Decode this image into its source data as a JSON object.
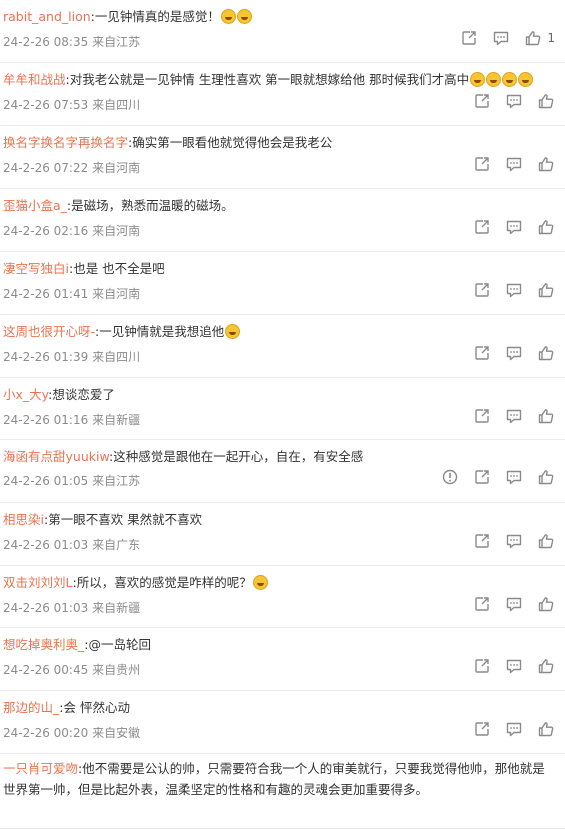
{
  "comments": [
    {
      "user": "rabit_and_lion",
      "text": "一见钟情真的是感觉！",
      "emoji_count": 2,
      "time": "24-2-26 08:35",
      "location": "来自江苏",
      "likes": "1",
      "report": false,
      "wrap": false
    },
    {
      "user": "牟牟和战战",
      "text": "对我老公就是一见钟情 生理性喜欢 第一眼就想嫁给他 那时候我们才高中",
      "emoji_count": 4,
      "time": "24-2-26 07:53",
      "location": "来自四川",
      "likes": "",
      "report": false,
      "wrap": false
    },
    {
      "user": "换名字换名字再换名字",
      "text": "确实第一眼看他就觉得他会是我老公",
      "emoji_count": 0,
      "time": "24-2-26 07:22",
      "location": "来自河南",
      "likes": "",
      "report": false,
      "wrap": false
    },
    {
      "user": "歪猫小盒a_",
      "text": "是磁场，熟悉而温暖的磁场。",
      "emoji_count": 0,
      "time": "24-2-26 02:16",
      "location": "来自河南",
      "likes": "",
      "report": false,
      "wrap": false
    },
    {
      "user": "凄空写独白i",
      "text": "也是 也不全是吧",
      "emoji_count": 0,
      "time": "24-2-26 01:41",
      "location": "来自河南",
      "likes": "",
      "report": false,
      "wrap": false
    },
    {
      "user": "这周也很开心呀-",
      "text": "一见钟情就是我想追他",
      "emoji_count": 1,
      "time": "24-2-26 01:39",
      "location": "来自四川",
      "likes": "",
      "report": false,
      "wrap": false
    },
    {
      "user": "小x_大y",
      "text": "想谈恋爱了",
      "emoji_count": 0,
      "time": "24-2-26 01:16",
      "location": "来自新疆",
      "likes": "",
      "report": false,
      "wrap": false
    },
    {
      "user": "海函有点甜yuukiw",
      "text": "这种感觉是跟他在一起开心，自在，有安全感",
      "emoji_count": 0,
      "time": "24-2-26 01:05",
      "location": "来自江苏",
      "likes": "",
      "report": true,
      "wrap": false
    },
    {
      "user": "相思染i",
      "text": "第一眼不喜欢 果然就不喜欢",
      "emoji_count": 0,
      "time": "24-2-26 01:03",
      "location": "来自广东",
      "likes": "",
      "report": false,
      "wrap": false
    },
    {
      "user": "双击刘刘刘L",
      "text": "所以，喜欢的感觉是咋样的呢？",
      "emoji_count": 1,
      "time": "24-2-26 01:03",
      "location": "来自新疆",
      "likes": "",
      "report": false,
      "wrap": false
    },
    {
      "user": "想吃掉奥利奥_",
      "text": "@一岛轮回",
      "emoji_count": 0,
      "time": "24-2-26 00:45",
      "location": "来自贵州",
      "likes": "",
      "report": false,
      "wrap": false
    },
    {
      "user": "那边的山_",
      "text": "会 怦然心动",
      "emoji_count": 0,
      "time": "24-2-26 00:20",
      "location": "来自安徽",
      "likes": "",
      "report": false,
      "wrap": false
    },
    {
      "user": "一只肖可爱吻",
      "text": "他不需要是公认的帅，只需要符合我一个人的审美就行，只要我觉得他帅，那他就是世界第一帅，但是比起外表，温柔坚定的性格和有趣的灵魂会更加重要得多。",
      "emoji_count": 0,
      "time": "",
      "location": "",
      "likes": "",
      "report": false,
      "wrap": true
    }
  ],
  "icons": {
    "share": "share-icon",
    "comment": "comment-icon",
    "like": "thumbs-up-icon",
    "report": "report-icon"
  },
  "colors": {
    "username": "#eb7350",
    "meta": "#8c8c8c",
    "icon": "#8a8a8a",
    "divider": "#ececec"
  }
}
